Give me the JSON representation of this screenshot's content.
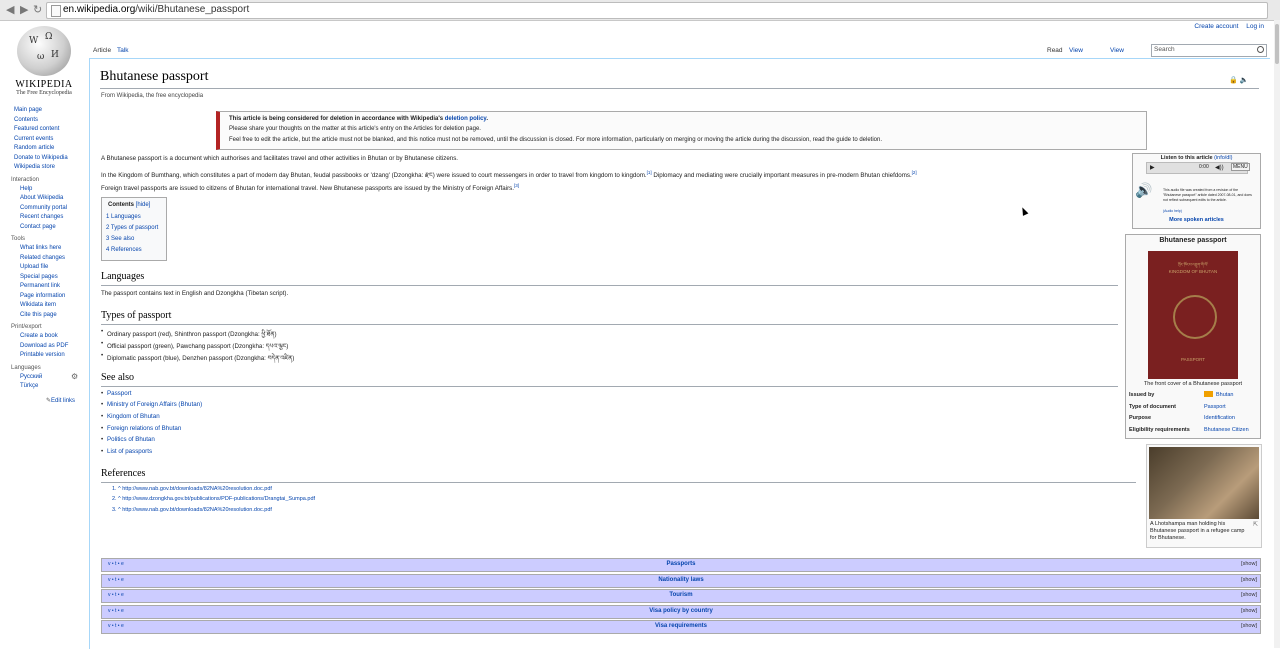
{
  "browser": {
    "url_host": "en.wikipedia.org",
    "url_path": "/wiki/Bhutanese_passport"
  },
  "logo": {
    "wordmark": "Wikipedia",
    "tagline": "The Free Encyclopedia"
  },
  "sidebar": {
    "main": [
      "Main page",
      "Contents",
      "Featured content",
      "Current events",
      "Random article",
      "Donate to Wikipedia",
      "Wikipedia store"
    ],
    "interaction_heading": "Interaction",
    "interaction": [
      "Help",
      "About Wikipedia",
      "Community portal",
      "Recent changes",
      "Contact page"
    ],
    "tools_heading": "Tools",
    "tools": [
      "What links here",
      "Related changes",
      "Upload file",
      "Special pages",
      "Permanent link",
      "Page information",
      "Wikidata item",
      "Cite this page"
    ],
    "print_heading": "Print/export",
    "print": [
      "Create a book",
      "Download as PDF",
      "Printable version"
    ],
    "lang_heading": "Languages",
    "languages": [
      "Русский",
      "Türkçe"
    ],
    "edit_links": "Edit links"
  },
  "tabs": {
    "article": "Article",
    "talk": "Talk",
    "read": "Read",
    "view_source": "View source",
    "view_history": "View history"
  },
  "personal": {
    "create_account": "Create account",
    "log_in": "Log in"
  },
  "search": {
    "placeholder": "Search"
  },
  "article": {
    "title": "Bhutanese passport",
    "subtitle": "From Wikipedia, the free encyclopedia",
    "notice": {
      "line1a": "This article is being considered for deletion in accordance with Wikipedia's ",
      "line1b": "deletion policy",
      "line1c": ".",
      "line2": "Please share your thoughts on the matter at this article's entry on the Articles for deletion page.",
      "line3": "Feel free to edit the article, but the article must not be blanked, and this notice must not be removed, until the discussion is closed. For more information, particularly on merging or moving the article during the discussion, read the guide to deletion."
    },
    "p1": "A Bhutanese passport is a document which authorises and facilitates travel and other activities in Bhutan or by Bhutanese citizens.",
    "p2": "In the Kingdom of Bumthang, which constitutes a part of modern day Bhutan, feudal passbooks or 'dzang' (Dzongkha: རྫང) were issued to court messengers in order to travel from kingdom to kingdom.",
    "p2b": " Diplomacy and mediating were crucially important measures in pre-modern Bhutan chiefdoms.",
    "p3": "Foreign travel passports are issued to citizens of Bhutan for international travel. New Bhutanese passports are issued by the Ministry of Foreign Affairs.",
    "sup1": "[1]",
    "sup2": "[2]",
    "sup3": "[3]",
    "toc": {
      "title": "Contents",
      "hide": "[hide]",
      "items": [
        "1 Languages",
        "2 Types of passport",
        "3 See also",
        "4 References"
      ]
    },
    "h_languages": "Languages",
    "languages_text": "The passport contains text in English and Dzongkha (Tibetan script).",
    "h_types": "Types of passport",
    "types": [
      "Ordinary passport (red), Shinthron passport (Dzongkha: ཕྱི་ཐོན)",
      "Official passport (green), Pawchang passport (Dzongkha: དཔའ་ལྕང)",
      "Diplomatic passport (blue), Denzhen passport (Dzongkha: བདེན་འཛིན)"
    ],
    "h_see_also": "See also",
    "see_also": [
      "Passport",
      "Ministry of Foreign Affairs (Bhutan)",
      "Kingdom of Bhutan",
      "Foreign relations of Bhutan",
      "Politics of Bhutan",
      "List of passports"
    ],
    "h_references": "References",
    "references": [
      "1. ^ http://www.nab.gov.bt/downloads/82NA%20resolution.doc.pdf",
      "2. ^ http://www.dzongkha.gov.bt/publications/PDF-publications/Drangtai_Sumpa.pdf",
      "3. ^ http://www.nab.gov.bt/downloads/82NA%20resolution.doc.pdf"
    ]
  },
  "audio": {
    "title": "Listen to this article",
    "info": "(info/dl)",
    "time": "0:00",
    "menu": "MENU",
    "desc": "This audio file was created from a revision of the \"Bhutanese passport\" article dated 2007-08-01, and does not reflect subsequent edits to the article.",
    "help": "(Audio help)",
    "more": "More spoken articles"
  },
  "infobox": {
    "title": "Bhutanese passport",
    "cover_top": "ཀྲོང་ཁོངས་འབྲུག་གི་ལོ་",
    "cover_kingdom": "KINGDOM OF BHUTAN",
    "cover_bottom": "PASSPORT",
    "caption": "The front cover of a Bhutanese passport",
    "rows": [
      {
        "label": "Issued by",
        "value": "Bhutan"
      },
      {
        "label": "Type of document",
        "value": "Passport"
      },
      {
        "label": "Purpose",
        "value": "Identification"
      },
      {
        "label": "Eligibility requirements",
        "value": "Bhutanese Citizen"
      }
    ],
    "flag_color": "#f0a000"
  },
  "thumb": {
    "caption": "A Lhotshampa man holding his Bhutanese passport in a refugee camp for Bhutanese."
  },
  "navboxes": {
    "vte": "v • t • e",
    "show": "[show]",
    "titles": [
      "Passports",
      "Nationality laws",
      "Tourism",
      "Visa policy by country",
      "Visa requirements"
    ]
  },
  "colors": {
    "link": "#0645ad",
    "navbox": "#ccccff",
    "notice_border": "#b32424"
  }
}
